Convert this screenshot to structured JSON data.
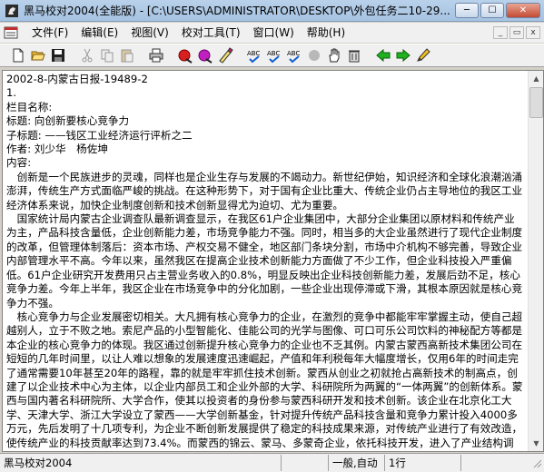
{
  "window": {
    "title": "黑马校对2004(全能版) - [C:\\USERS\\ADMINISTRATOR\\DESKTOP\\外包任务二10-29...",
    "minimize": "─",
    "maximize": "☐",
    "close": "✕"
  },
  "menu": {
    "items": [
      "文件(F)",
      "编辑(E)",
      "视图(V)",
      "校对工具(T)",
      "窗口(W)",
      "帮助(H)"
    ],
    "mdi_minimize": "_",
    "mdi_restore": "▭",
    "mdi_close": "x"
  },
  "toolbar": {
    "icons": [
      "new-icon",
      "open-icon",
      "save-icon",
      "cut-icon",
      "copy-icon",
      "paste-icon",
      "print-icon",
      "check-red-icon",
      "check-purple-icon",
      "brush-icon",
      "abc-check-icon",
      "abc-replace-icon",
      "abc-correct-icon",
      "record-icon",
      "hand-icon",
      "trash-icon",
      "prev-icon",
      "next-icon",
      "pencil-icon"
    ]
  },
  "document": {
    "lines": [
      "2002-8-内蒙古日报-19489-2",
      "1.",
      "栏目名称:",
      "标题: 向创新要核心竞争力",
      "子标题: ——钱区工业经济运行评析之二",
      "作者: 刘少华　杨佐坤",
      "内容:"
    ],
    "paragraphs": [
      "　创新是一个民族进步的灵魂，同样也是企业生存与发展的不竭动力。新世纪伊始，知识经济和全球化浪潮汹涌澎湃，传统生产方式面临严峻的挑战。在这种形势下，对于国有企业比重大、传统企业仍占主导地位的我区工业经济体系来说，加快企业制度创新和技术创新显得尤为迫切、尤为重要。",
      "　国家统计局内蒙古企业调查队最新调查显示，在我区61户企业集团中，大部分企业集团以原材料和传统产业为主，产品科技含量低，企业创新能力差，市场竞争能力不强。同时，相当多的大企业虽然进行了现代企业制度的改革，但管理体制落后：资本市场、产权交易不健全，地区部门条块分割，市场中介机构不够完善，导致企业内部管理水平不高。今年以来，虽然我区在提高企业技术创新能力方面做了不少工作，但企业科技投入严重偏低。61户企业研究开发费用只占主营业务收入的0.8%，明显反映出企业科技创新能力差，发展后劲不足，核心竞争力差。今年上半年，我区企业在市场竞争中的分化加剧，一些企业出现停滞或下滑，其根本原因就是核心竞争力不强。",
      "　核心竞争力与企业发展密切相关。大凡拥有核心竞争力的企业，在激烈的竞争中都能牢牢掌握主动，使自己超越别人，立于不败之地。索尼产品的小型智能化、佳能公司的光学与图像、可口可乐公司饮料的神秘配方等都是本企业的核心竞争力的体现。我区通过创新提升核心竞争力的企业也不乏其例。内蒙古蒙西高新技术集团公司在短短的几年时间里，以让人难以想象的发展速度迅速崛起，产值和年利税每年大幅度增长，仅用6年的时间走完了通常需要10年甚至20年的路程，靠的就是牢牢抓住技术创新。蒙西从创业之初就抢占高新技术的制高点，创建了以企业技术中心为主体，以企业内部员工和企业外部的大学、科研院所为两翼的“一体两翼”的创新体系。蒙西与国内著名科研院所、大学合作，使其以投资者的身份参与蒙西科研开发和技术创新。该企业在北京化工大学、天津大学、浙江大学设立了蒙西——大学创新基金，针对提升传统产品科技含量和竞争力累计投入4000多万元，先后发明了十几项专利，为企业不断创新发展提供了稳定的科技成果来源，对传统产业进行了有效改造，使传统产业的科技贡献率达到73.4%。而蒙西的锦云、蒙马、多蒙奇企业，依托科技开发，进入了产业结构调整和转型升级的快车道，收效良好。"
    ]
  },
  "statusbar": {
    "app_name": "黑马校对2004",
    "mode": "一般,自动",
    "line": "1行"
  }
}
